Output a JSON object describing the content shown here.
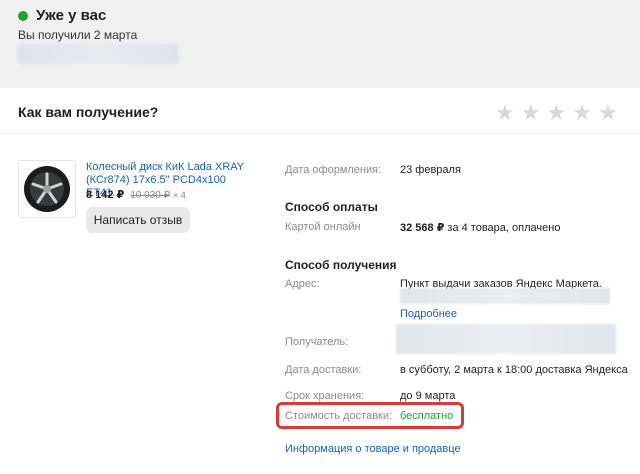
{
  "status": {
    "title": "Уже у вас",
    "subtitle": "Вы получили 2 марта",
    "color": "#21a038"
  },
  "rating": {
    "title": "Как вам получение?",
    "stars_total": 5,
    "stars_filled": 0,
    "star_glyph": "★"
  },
  "product": {
    "image_icon": "wheel-icon",
    "name": "Колесный диск КиК Lada XRAY (КСr874) 17x6.5\" PCD4x100 ET41...",
    "price": "8 142 ₽",
    "old_price": "10 030 ₽",
    "quantity": "× 4",
    "review_button": "Написать отзыв"
  },
  "order": {
    "date_label": "Дата оформления:",
    "date_value": "23 февраля"
  },
  "payment": {
    "title": "Способ оплаты",
    "method_label": "Картой онлайн",
    "amount": "32 568 ₽",
    "amount_note": " за 4 товара, оплачено"
  },
  "delivery": {
    "title": "Способ получения",
    "address_label": "Адрес:",
    "address_value": "Пункт выдачи заказов Яндекс Маркета.",
    "more_link": "Подробнее",
    "recipient_label": "Получатель:",
    "delivery_date_label": "Дата доставки:",
    "delivery_date_value": "в субботу, 2 марта к 18:00 доставка Яндекса",
    "storage_label": "Срок хранения:",
    "storage_value": "до 9 марта",
    "cost_label": "Стоимость доставки:",
    "cost_value": "бесплатно",
    "info_link": "Информация о товаре и продавце"
  },
  "colors": {
    "link": "#1a5fb4",
    "accent_green": "#21a038",
    "highlight_red": "#d93a3a"
  }
}
